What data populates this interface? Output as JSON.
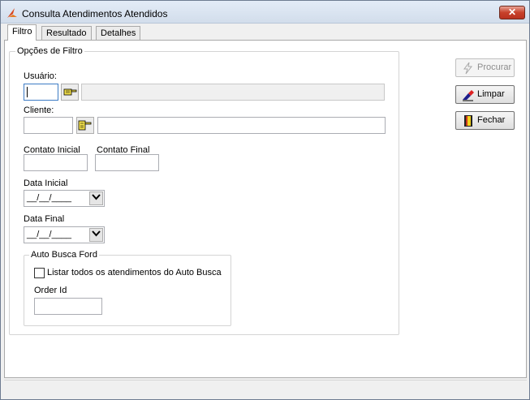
{
  "window": {
    "title": "Consulta Atendimentos Atendidos",
    "close_label": "✕"
  },
  "tabs": [
    {
      "label": "Filtro",
      "active": true
    },
    {
      "label": "Resultado",
      "active": false
    },
    {
      "label": "Detalhes",
      "active": false
    }
  ],
  "filter": {
    "group_title": "Opções de Filtro",
    "usuario_label": "Usuário:",
    "usuario_value": "",
    "usuario_name": "",
    "cliente_label": "Cliente:",
    "cliente_value": "",
    "cliente_name": "",
    "contato_inicial_label": "Contato Inicial",
    "contato_inicial_value": "",
    "contato_final_label": "Contato Final",
    "contato_final_value": "",
    "data_inicial_label": "Data Inicial",
    "data_inicial_value": "__/__/____",
    "data_final_label": "Data Final",
    "data_final_value": "__/__/____",
    "auto_busca": {
      "group_title": "Auto Busca Ford",
      "checkbox_label": "Listar todos os atendimentos do Auto Busca",
      "checked": false,
      "order_id_label": "Order Id",
      "order_id_value": ""
    }
  },
  "actions": {
    "procurar": {
      "label": "Procurar",
      "enabled": false
    },
    "limpar": {
      "label": "Limpar",
      "enabled": true
    },
    "fechar": {
      "label": "Fechar",
      "enabled": true
    }
  },
  "icons": {
    "app": "app-logo-icon",
    "usuario_lookup": "pointing-hand-icon",
    "cliente_lookup": "pointing-hand-icon",
    "procurar": "lightning-icon",
    "limpar": "eraser-icon",
    "fechar": "exit-door-icon",
    "dropdown": "chevron-down-icon"
  },
  "colors": {
    "close_button": "#c7412a",
    "focus_border": "#3d7bc4"
  }
}
